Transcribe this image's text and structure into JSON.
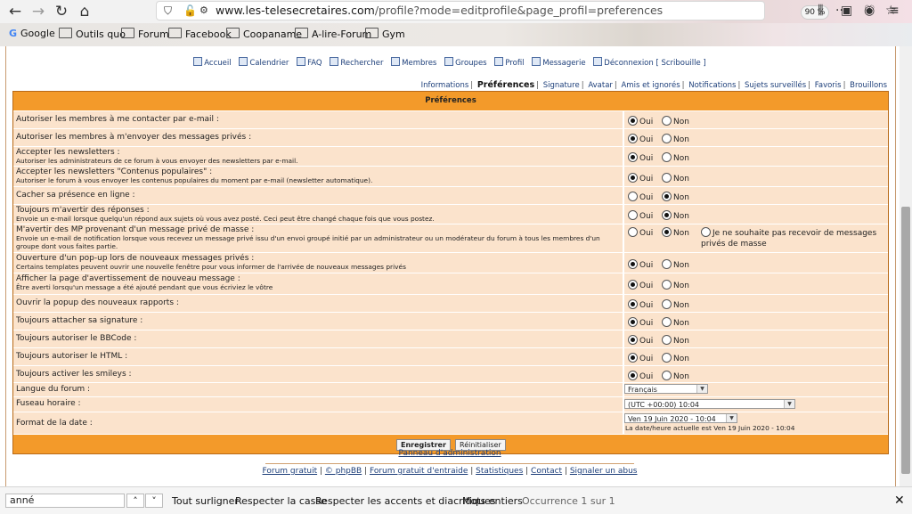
{
  "browser": {
    "url_domain": "www.les-telesecretaires.com",
    "url_path": "/profile?mode=editprofile&page_profil=preferences",
    "zoom": "90 %",
    "bookmarks": [
      "Google",
      "Outils quo",
      "Forum",
      "Facebook",
      "Coopaname",
      "A-lire-Forum",
      "Gym"
    ]
  },
  "nav": {
    "items": [
      "Accueil",
      "Calendrier",
      "FAQ",
      "Rechercher",
      "Membres",
      "Groupes",
      "Profil",
      "Messagerie",
      "Déconnexion [ Scribouille ]"
    ]
  },
  "profile_tabs": {
    "items": [
      "Informations",
      "Préférences",
      "Signature",
      "Avatar",
      "Amis et ignorés",
      "Notifications",
      "Sujets surveillés",
      "Favoris",
      "Brouillons"
    ],
    "current_index": 1
  },
  "form": {
    "title": "Préférences",
    "yes_label": "Oui",
    "no_label": "Non",
    "rows": [
      {
        "title": "Autoriser les membres à me contacter par e-mail :",
        "desc": "",
        "selected": "oui"
      },
      {
        "title": "Autoriser les membres à m'envoyer des messages privés :",
        "desc": "",
        "selected": "oui"
      },
      {
        "title": "Accepter les newsletters :",
        "desc": "Autoriser les administrateurs de ce forum à vous envoyer des newsletters par e-mail.",
        "selected": "oui"
      },
      {
        "title": "Accepter les newsletters \"Contenus populaires\" :",
        "desc": "Autoriser le forum à vous envoyer les contenus populaires du moment par e-mail (newsletter automatique).",
        "selected": "oui"
      },
      {
        "title": "Cacher sa présence en ligne :",
        "desc": "",
        "selected": "non"
      },
      {
        "title": "Toujours m'avertir des réponses :",
        "desc": "Envoie un e-mail lorsque quelqu'un répond aux sujets où vous avez posté. Ceci peut être changé chaque fois que vous postez.",
        "selected": "non"
      },
      {
        "title": "M'avertir des MP provenant d'un message privé de masse :",
        "desc": "Envoie un e-mail de notification lorsque vous recevez un message privé issu d'un envoi groupé initié par un administrateur ou un modérateur du forum à tous les membres d'un groupe dont vous faites partie.",
        "selected": "non",
        "extra_option": "Je ne souhaite pas recevoir de messages privés de masse"
      },
      {
        "title": "Ouverture d'un pop-up lors de nouveaux messages privés :",
        "desc": "Certains templates peuvent ouvrir une nouvelle fenêtre pour vous informer de l'arrivée de nouveaux messages privés",
        "selected": "oui"
      },
      {
        "title": "Afficher la page d'avertissement de nouveau message :",
        "desc": "Être averti lorsqu'un message a été ajouté pendant que vous écriviez le vôtre",
        "selected": "oui"
      },
      {
        "title": "Ouvrir la popup des nouveaux rapports :",
        "desc": "",
        "selected": "oui"
      },
      {
        "title": "Toujours attacher sa signature :",
        "desc": "",
        "selected": "oui"
      },
      {
        "title": "Toujours autoriser le BBCode :",
        "desc": "",
        "selected": "oui"
      },
      {
        "title": "Toujours autoriser le HTML :",
        "desc": "",
        "selected": "oui"
      },
      {
        "title": "Toujours activer les smileys :",
        "desc": "",
        "selected": "oui"
      }
    ],
    "language": {
      "label": "Langue du forum :",
      "value": "Français"
    },
    "timezone": {
      "label": "Fuseau horaire :",
      "value": "(UTC +00:00) 10:04"
    },
    "date_format": {
      "label": "Format de la date :",
      "value": "Ven 19 Juin 2020 - 10:04",
      "note": "La date/heure actuelle est Ven 19 Juin 2020 - 10:04"
    },
    "submit_label": "Enregistrer",
    "reset_label": "Réinitialiser"
  },
  "admin_link": "Panneau d'administration",
  "footer": {
    "links": [
      "Forum gratuit",
      "© phpBB",
      "Forum gratuit d'entraide",
      "Statistiques",
      "Contact",
      "Signaler un abus"
    ]
  },
  "findbar": {
    "query": "anné",
    "highlight_all": "Tout surligner",
    "match_case": "Respecter la casse",
    "match_diacritics": "Respecter les accents et diacritiques",
    "whole_words": "Mots entiers",
    "status": "Occurrence 1 sur 1"
  }
}
